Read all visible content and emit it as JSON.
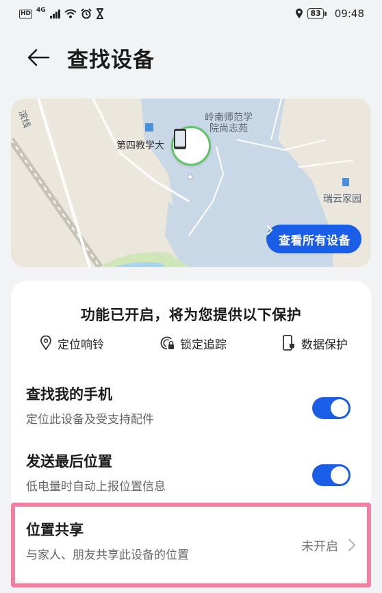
{
  "status_bar": {
    "hd": "HD",
    "network": "4G",
    "battery": "83",
    "time": "09:48"
  },
  "header": {
    "back_icon": "arrow-left-icon",
    "title": "查找设备"
  },
  "map": {
    "labels": {
      "road": "滨线",
      "campus": "岭南师范学院尚志苑",
      "building": "第四教学大",
      "residence": "瑞云家园"
    },
    "view_all_button": "查看所有设备"
  },
  "card": {
    "headline": "功能已开启，将为您提供以下保护",
    "features": [
      {
        "label": "定位响铃",
        "icon": "location-pin-icon"
      },
      {
        "label": "锁定追踪",
        "icon": "lock-track-icon"
      },
      {
        "label": "数据保护",
        "icon": "phone-shield-icon"
      }
    ],
    "settings": [
      {
        "title": "查找我的手机",
        "subtitle": "定位此设备及受支持配件",
        "enabled": true
      },
      {
        "title": "发送最后位置",
        "subtitle": "低电量时自动上报位置信息",
        "enabled": true
      }
    ],
    "location_sharing": {
      "title": "位置共享",
      "subtitle": "与家人、朋友共享此设备的位置",
      "status": "未开启"
    }
  },
  "colors": {
    "accent": "#1a5ee8",
    "highlight": "#f07fa2",
    "pin_ring": "#5fc46a"
  }
}
